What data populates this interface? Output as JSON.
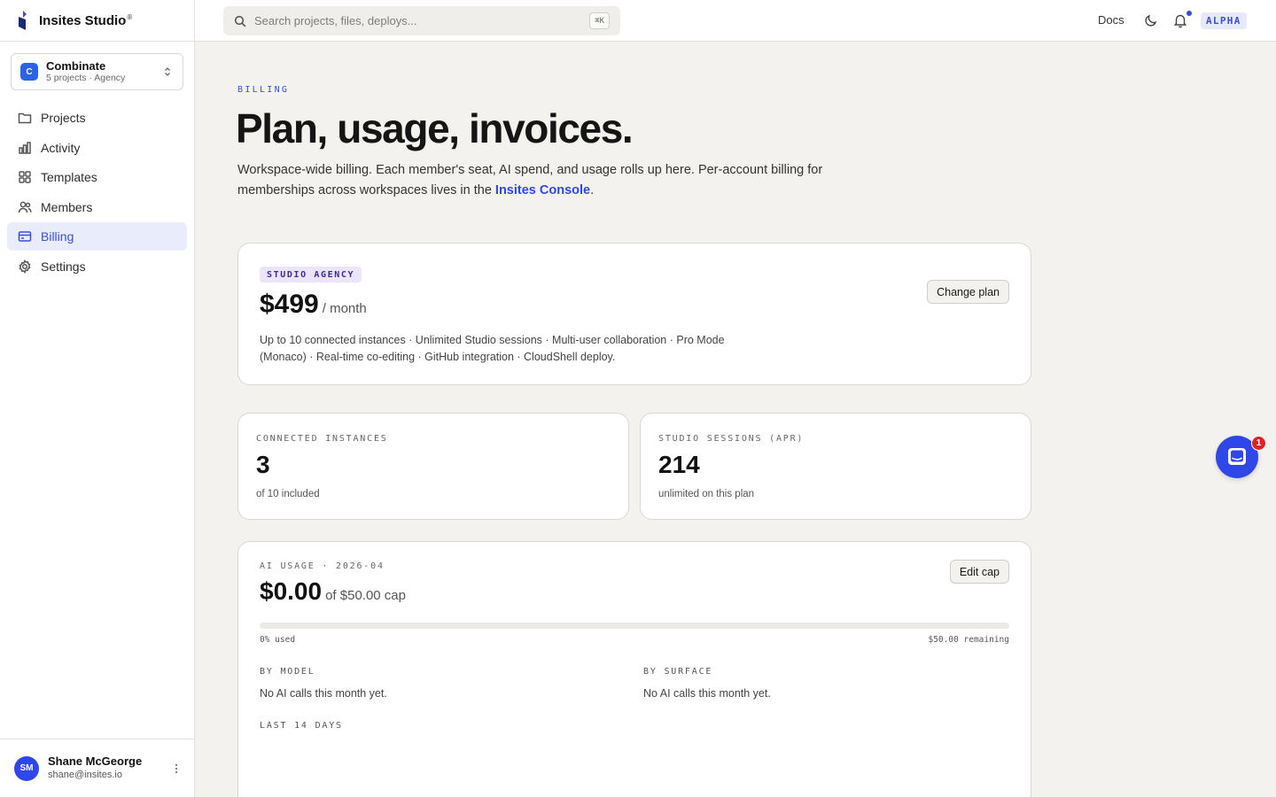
{
  "app": {
    "name": "Insites Studio",
    "registered_mark": "®"
  },
  "workspace": {
    "initial": "C",
    "name": "Combinate",
    "meta": "5 projects · Agency"
  },
  "sidebar": {
    "items": [
      {
        "label": "Projects",
        "icon": "folder-icon"
      },
      {
        "label": "Activity",
        "icon": "bar-chart-icon"
      },
      {
        "label": "Templates",
        "icon": "grid-icon"
      },
      {
        "label": "Members",
        "icon": "users-icon"
      },
      {
        "label": "Billing",
        "icon": "credit-card-icon",
        "active": true
      },
      {
        "label": "Settings",
        "icon": "gear-icon"
      }
    ]
  },
  "user": {
    "initials": "SM",
    "name": "Shane McGeorge",
    "email": "shane@insites.io"
  },
  "topbar": {
    "search_placeholder": "Search projects, files, deploys...",
    "shortcut": "⌘K",
    "docs_label": "Docs",
    "badge": "ALPHA"
  },
  "page": {
    "eyebrow": "BILLING",
    "title": "Plan, usage, invoices.",
    "lead_text": "Workspace-wide billing. Each member's seat, AI spend, and usage rolls up here. Per-account billing for memberships across workspaces lives in the ",
    "lead_link": "Insites Console",
    "lead_end": "."
  },
  "plan": {
    "badge": "STUDIO AGENCY",
    "price": "$499",
    "period": "/ month",
    "features": "Up to 10 connected instances · Unlimited Studio sessions · Multi-user collaboration · Pro Mode (Monaco) · Real-time co-editing · GitHub integration · CloudShell deploy.",
    "button": "Change plan"
  },
  "stats": [
    {
      "label": "CONNECTED INSTANCES",
      "value": "3",
      "sub": "of 10 included"
    },
    {
      "label": "STUDIO SESSIONS (APR)",
      "value": "214",
      "sub": "unlimited on this plan"
    }
  ],
  "ai_usage": {
    "label": "AI USAGE · 2026-04",
    "value": "$0.00",
    "cap": "of $50.00 cap",
    "button": "Edit cap",
    "progress_fraction": 0,
    "used_text": "0% used",
    "remaining_text": "$50.00 remaining",
    "by_model_label": "BY MODEL",
    "by_model_text": "No AI calls this month yet.",
    "by_surface_label": "BY SURFACE",
    "by_surface_text": "No AI calls this month yet.",
    "last_days_label": "LAST 14 DAYS"
  },
  "chat": {
    "unread": "1"
  },
  "colors": {
    "accent": "#3a4fd6",
    "brand_blue": "#2f47e8",
    "badge_red": "#e02424"
  }
}
